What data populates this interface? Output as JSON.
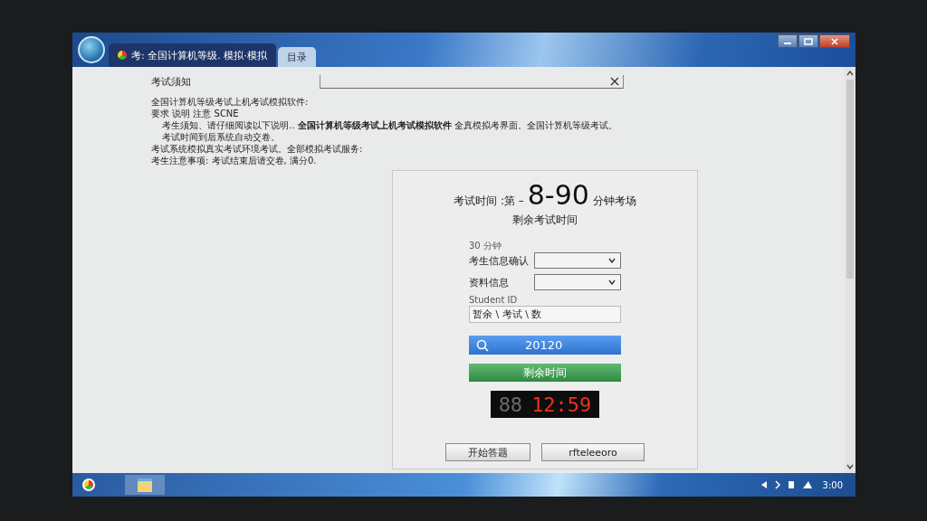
{
  "window": {
    "tabs": [
      {
        "label": "考: 全国计算机等级. 模拟·模拟",
        "selected": true
      },
      {
        "label": "目录",
        "selected": false
      }
    ]
  },
  "notice": {
    "title": "考试须知",
    "lines": [
      {
        "text": "全国计算机等级考试上机考试模拟软件:",
        "indent": false
      },
      {
        "text": "要求 说明 注意 SCNE",
        "indent": false
      },
      {
        "text": "考生须知、请仔细阅读以下说明.. **全国计算机等级考试上机考试模拟软件** 全真模拟考界面。全国计算机等级考试。",
        "indent": true
      },
      {
        "text": "考试时间到后系统自动交卷。",
        "indent": true
      },
      {
        "text": "考试系统模拟真实考试环境考试。全部模拟考试服务:",
        "indent": false
      },
      {
        "text": "考生注意事项: 考试结束后请交卷, 满分0.",
        "indent": false
      }
    ]
  },
  "panel": {
    "heading_prefix": "考试时间 :第 –",
    "heading_big": "8-90",
    "heading_suffix": "分钟考场",
    "subheading": "剩余考试时间",
    "fields": [
      {
        "kind": "select",
        "caption": "30 分钟",
        "label": "考生信息确认"
      },
      {
        "kind": "select",
        "label": "资料信息"
      },
      {
        "kind": "text",
        "caption": "Student ID",
        "value": "暂余 \\ 考试 \\ 数"
      }
    ],
    "search_bar": {
      "value": "20120"
    },
    "time_button": "剩余时间",
    "timer": {
      "dim": "88",
      "time": "12:59"
    },
    "buttons": [
      "开始答题",
      "rfteleeoro"
    ]
  },
  "taskbar": {
    "clock": "3:00"
  }
}
